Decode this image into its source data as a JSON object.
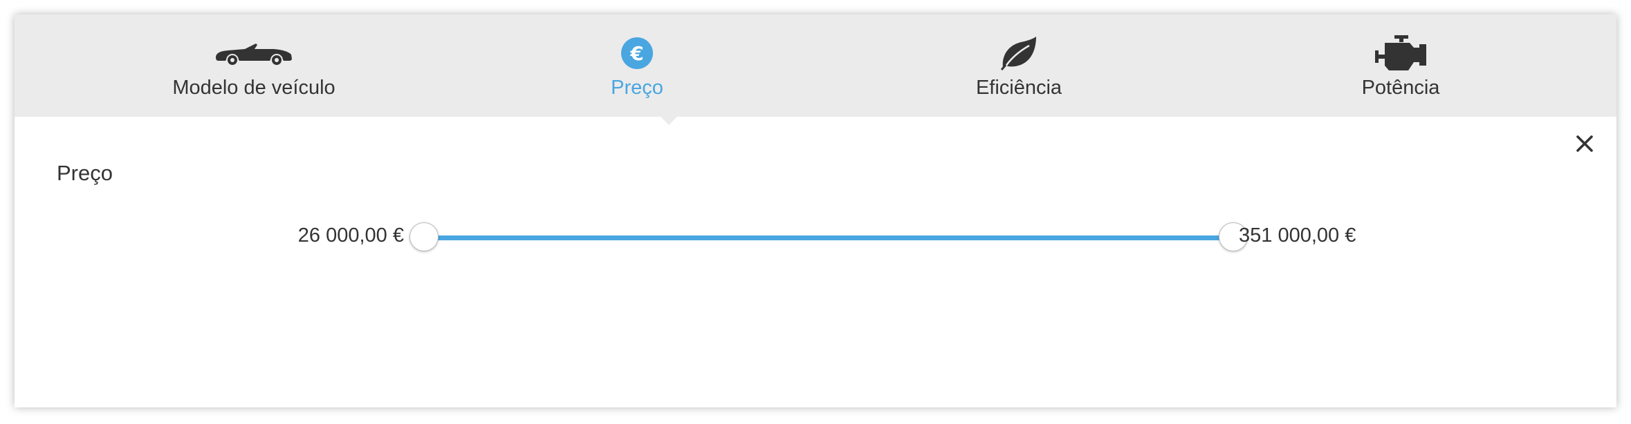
{
  "tabs": [
    {
      "label": "Modelo de veículo",
      "icon": "car-convertible-icon",
      "active": false
    },
    {
      "label": "Preço",
      "icon": "euro-icon",
      "icon_glyph": "€",
      "active": true
    },
    {
      "label": "Eficiência",
      "icon": "leaf-icon",
      "active": false
    },
    {
      "label": "Potência",
      "icon": "engine-icon",
      "active": false
    }
  ],
  "filter": {
    "title": "Preço",
    "range_min_label": "26 000,00 €",
    "range_max_label": "351 000,00 €",
    "selected_min_fraction": 0,
    "selected_max_fraction": 1
  },
  "close_icon": "close-icon",
  "colors": {
    "accent": "#49a6e0",
    "tabbar_bg": "#ebebeb",
    "text": "#333333"
  }
}
